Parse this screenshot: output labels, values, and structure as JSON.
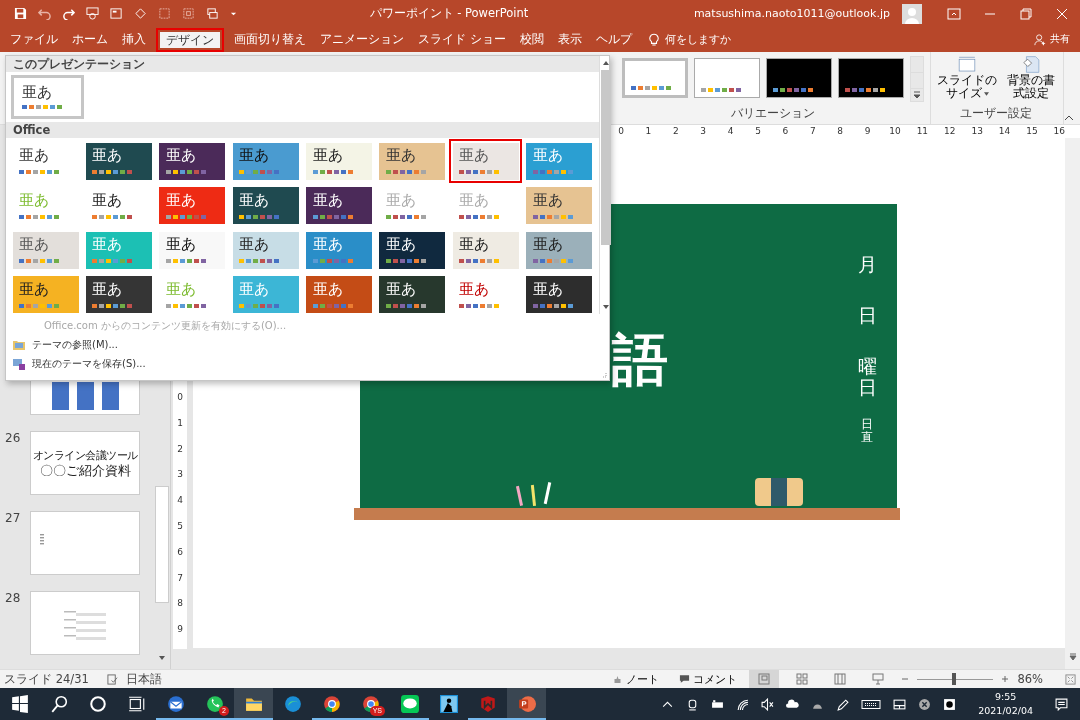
{
  "title_bar": {
    "title": "パワーポイント - PowerPoint",
    "account": "matsushima.naoto1011@outlook.jp"
  },
  "tabs": [
    {
      "label": "ファイル",
      "selected": false
    },
    {
      "label": "ホーム",
      "selected": false
    },
    {
      "label": "挿入",
      "selected": false
    },
    {
      "label": "デザイン",
      "selected": true
    },
    {
      "label": "画面切り替え",
      "selected": false
    },
    {
      "label": "アニメーション",
      "selected": false
    },
    {
      "label": "スライド ショー",
      "selected": false
    },
    {
      "label": "校閲",
      "selected": false
    },
    {
      "label": "表示",
      "selected": false
    },
    {
      "label": "ヘルプ",
      "selected": false
    }
  ],
  "tell_me": "何をしますか",
  "share": "共有",
  "ribbon": {
    "variations": [
      {
        "color": "#ffffff",
        "selected": true
      },
      {
        "color": "#ffffff",
        "selected": false
      },
      {
        "color": "#000000",
        "selected": false
      },
      {
        "color": "#000000",
        "selected": false
      }
    ],
    "variations_label": "バリエーション",
    "custom_buttons": [
      {
        "kind": "size",
        "lines": [
          "スライドの",
          "サイズ"
        ],
        "dropdown": true
      },
      {
        "kind": "background",
        "lines": [
          "背景の書",
          "式設定"
        ],
        "dropdown": false
      }
    ],
    "custom_label": "ユーザー設定"
  },
  "theme_gallery": {
    "this_presentation_label": "このプレゼンテーション",
    "current": [
      {
        "label": "亜あ",
        "label_style": {
          "color": "#333333"
        },
        "color": "#ffffff",
        "selected": true
      }
    ],
    "office_label": "Office",
    "themes": [
      {
        "label": "亜あ",
        "label_style": {
          "color": "#333333"
        },
        "color": "#ffffff",
        "selected": false
      },
      {
        "label": "亜あ",
        "label_style": {
          "color": "#ffffff"
        },
        "color": "#1f4a50",
        "selected": false
      },
      {
        "label": "亜あ",
        "label_style": {
          "color": "#ffffff"
        },
        "color": "#4b2a59",
        "selected": false
      },
      {
        "label": "亜あ",
        "label_style": {
          "color": "#111111"
        },
        "color": "#4a9bd0",
        "selected": false
      },
      {
        "label": "亜あ",
        "label_style": {
          "color": "#222222"
        },
        "color": "#f4f4e6",
        "selected": false
      },
      {
        "label": "亜あ",
        "label_style": {
          "color": "#333333"
        },
        "color": "#e6c392",
        "selected": false
      },
      {
        "label": "亜あ",
        "label_style": {
          "color": "#555555"
        },
        "color": "#ebe6e3",
        "selected": true
      },
      {
        "label": "亜あ",
        "label_style": {
          "color": "#ffffff"
        },
        "color": "#2b9fd2",
        "selected": false
      },
      {
        "label": "亜あ",
        "label_style": {
          "color": "#7cbb2e"
        },
        "color": "#ffffff",
        "selected": false
      },
      {
        "label": "亜あ",
        "label_style": {
          "color": "#222222"
        },
        "color": "#ffffff",
        "selected": false
      },
      {
        "label": "亜あ",
        "label_style": {
          "color": "#ffffff"
        },
        "color": "#ee2b14",
        "selected": false
      },
      {
        "label": "亜あ",
        "label_style": {
          "color": "#ffffff"
        },
        "color": "#1f4a50",
        "selected": false
      },
      {
        "label": "亜あ",
        "label_style": {
          "color": "#ffffff"
        },
        "color": "#4b2a59",
        "selected": false
      },
      {
        "label": "亜あ",
        "label_style": {
          "color": "#aaaaaa"
        },
        "color": "#ffffff",
        "selected": false
      },
      {
        "label": "亜あ",
        "label_style": {
          "color": "#aaaaaa"
        },
        "color": "#ffffff",
        "selected": false
      },
      {
        "label": "亜あ",
        "label_style": {
          "color": "#333333"
        },
        "color": "#e6c392",
        "selected": false
      },
      {
        "label": "亜あ",
        "label_style": {
          "color": "#555555"
        },
        "color": "#e3dfdb",
        "selected": false
      },
      {
        "label": "亜あ",
        "label_style": {
          "color": "#ffffff"
        },
        "color": "#1cc0b4",
        "selected": false
      },
      {
        "label": "亜あ",
        "label_style": {
          "color": "#111111"
        },
        "color": "#f8f8f8",
        "selected": false
      },
      {
        "label": "亜あ",
        "label_style": {
          "color": "#222222"
        },
        "color": "#c7dde6",
        "selected": false
      },
      {
        "label": "亜あ",
        "label_style": {
          "color": "#ffffff"
        },
        "color": "#2a8ec8",
        "selected": false
      },
      {
        "label": "亜あ",
        "label_style": {
          "color": "#ffffff"
        },
        "color": "#10293f",
        "selected": false
      },
      {
        "label": "亜あ",
        "label_style": {
          "color": "#222222"
        },
        "color": "#efebe3",
        "selected": false
      },
      {
        "label": "亜あ",
        "label_style": {
          "color": "#222222"
        },
        "color": "#9bb0ba",
        "selected": false
      },
      {
        "label": "亜あ",
        "label_style": {
          "color": "#222222"
        },
        "color": "#f5b222",
        "selected": false
      },
      {
        "label": "亜あ",
        "label_style": {
          "color": "#ffffff"
        },
        "color": "#353535",
        "selected": false
      },
      {
        "label": "亜あ",
        "label_style": {
          "color": "#7cbb2e"
        },
        "color": "#ffffff",
        "selected": false
      },
      {
        "label": "亜あ",
        "label_style": {
          "color": "#ffffff"
        },
        "color": "#3cb6d6",
        "selected": false
      },
      {
        "label": "亜あ",
        "label_style": {
          "color": "#ffffff"
        },
        "color": "#c44c16",
        "selected": false
      },
      {
        "label": "亜あ",
        "label_style": {
          "color": "#ffffff"
        },
        "color": "#27382d",
        "selected": false
      },
      {
        "label": "亜あ",
        "label_style": {
          "color": "#c00000"
        },
        "color": "#ffffff",
        "selected": false
      },
      {
        "label": "亜あ",
        "label_style": {
          "color": "#ffffff"
        },
        "color": "#2d2d2d",
        "selected": false
      }
    ],
    "commands": [
      {
        "kind": "none",
        "label": "Office.com からのコンテンツ更新を有効にする(O)...",
        "disabled": true
      },
      {
        "kind": "browse",
        "label": "テーマの参照(M)...",
        "disabled": false
      },
      {
        "kind": "save",
        "label": "現在のテーマを保存(S)...",
        "disabled": false
      }
    ]
  },
  "slides": [
    {
      "kind": "bars"
    },
    {
      "number": "26",
      "kind": "title",
      "lines": [
        "オンライン会議ツール",
        "〇〇ご紹介資料"
      ]
    },
    {
      "number": "27",
      "kind": "list"
    },
    {
      "number": "28",
      "kind": "outline"
    }
  ],
  "rulers": {
    "horizontal": [
      "0",
      "1",
      "2",
      "3",
      "4",
      "5",
      "6",
      "7",
      "8",
      "9",
      "10",
      "11",
      "12",
      "13",
      "14",
      "15",
      "16"
    ],
    "vertical": [
      "0",
      "1",
      "2",
      "3",
      "4",
      "5",
      "6",
      "7",
      "8",
      "9"
    ]
  },
  "slide": {
    "title": "語",
    "date_labels": [
      "月",
      "日",
      "曜日"
    ],
    "duty_label": "日直"
  },
  "status_bar": {
    "slide": "スライド 24/31",
    "language": "日本語",
    "notes": "ノート",
    "comments": "コメント",
    "views": [
      {
        "kind": "normal",
        "selected": true
      },
      {
        "kind": "sorter",
        "selected": false
      },
      {
        "kind": "reading",
        "selected": false
      },
      {
        "kind": "show",
        "selected": false
      }
    ],
    "zoom": {
      "level": 0.45,
      "reading": "86%"
    }
  },
  "taskbar": {
    "apps": [
      {
        "kind": "start",
        "running": false,
        "selected": false
      },
      {
        "kind": "search",
        "running": false,
        "selected": false
      },
      {
        "kind": "cortana",
        "running": false,
        "selected": false
      },
      {
        "kind": "taskview",
        "running": false,
        "selected": false
      },
      {
        "kind": "mail",
        "running": true,
        "selected": false
      },
      {
        "kind": "chat",
        "running": true,
        "selected": false,
        "badge": "2"
      },
      {
        "kind": "folder",
        "running": true,
        "selected": true
      },
      {
        "kind": "edge",
        "running": false,
        "selected": false
      },
      {
        "kind": "chrome",
        "running": true,
        "selected": false
      },
      {
        "kind": "chrome",
        "running": true,
        "selected": false,
        "badge": "YS"
      },
      {
        "kind": "line",
        "running": true,
        "selected": false
      },
      {
        "kind": "reader",
        "running": false,
        "selected": false
      },
      {
        "kind": "shield",
        "running": true,
        "selected": false
      },
      {
        "kind": "powerpoint",
        "running": true,
        "selected": true
      }
    ],
    "clock": {
      "time": "9:55",
      "date": "2021/02/04"
    }
  }
}
